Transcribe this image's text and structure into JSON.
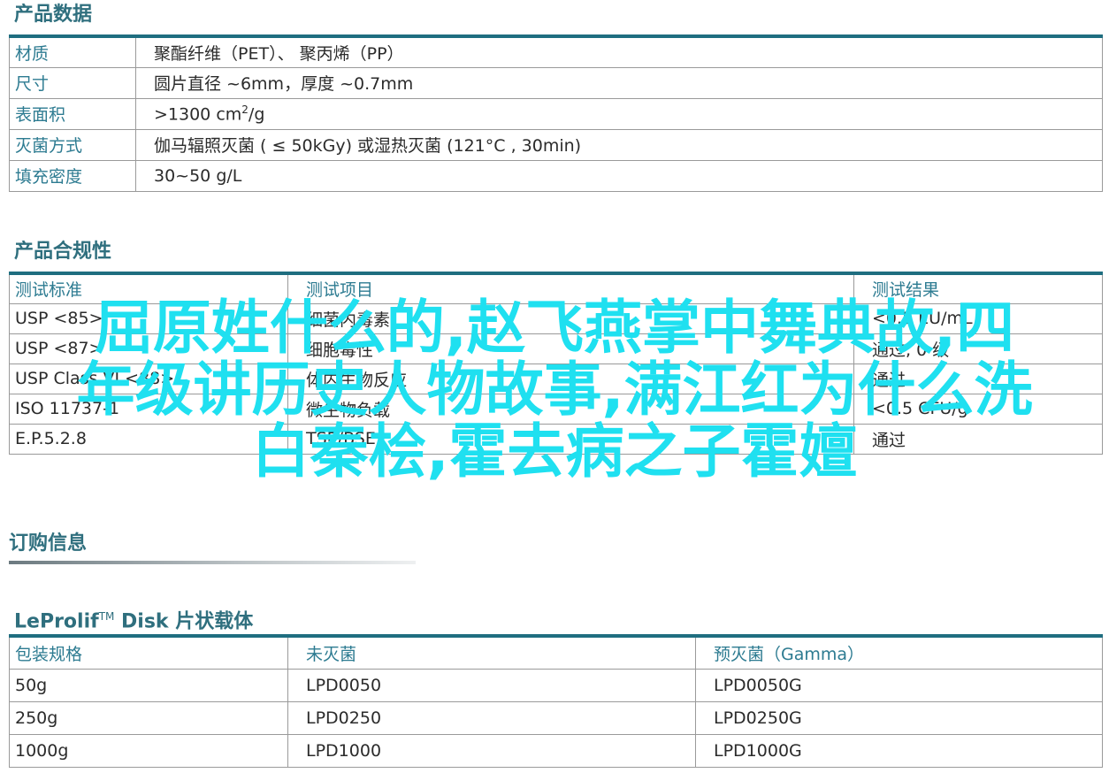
{
  "product_data": {
    "title": "产品数据",
    "rows": [
      {
        "key": "材质",
        "value": "聚酯纤维（PET）、 聚丙烯（PP）"
      },
      {
        "key": "尺寸",
        "value": "圆片直径 ~6mm，厚度 ~0.7mm"
      },
      {
        "key": "表面积",
        "value_prefix": ">1300 cm",
        "value_sup": "2",
        "value_suffix": "/g"
      },
      {
        "key": "灭菌方式",
        "value": "伽马辐照灭菌 ( ≤ 50kGy) 或湿热灭菌 (121°C , 30min)"
      },
      {
        "key": "填充密度",
        "value": "30~50 g/L"
      }
    ]
  },
  "compliance": {
    "title": "产品合规性",
    "headers": [
      "测试标准",
      "测试项目",
      "测试结果"
    ],
    "rows": [
      [
        "USP <85>",
        "细菌内毒素",
        "<0.5 EU/mL"
      ],
      [
        "USP <87>",
        "细胞毒性",
        "通过, 0 级"
      ],
      [
        "USP Class VI <88>",
        "体内生物反应",
        "通过"
      ],
      [
        "ISO 11737-1",
        "微生物负载",
        "<0.5 CFU/g"
      ],
      [
        "E.P.5.2.8",
        "TSE/BSE",
        "通过"
      ]
    ]
  },
  "order": {
    "title": "订购信息"
  },
  "disk": {
    "title_brand": "LeProlif",
    "title_tm": "TM",
    "title_rest": " Disk 片状载体",
    "headers": [
      "包装规格",
      "未灭菌",
      "预灭菌（Gamma）"
    ],
    "rows": [
      [
        "50g",
        "LPD0050",
        "LPD0050G"
      ],
      [
        "250g",
        "LPD0250",
        "LPD0250G"
      ],
      [
        "1000g",
        "LPD1000",
        "LPD1000G"
      ]
    ]
  },
  "overlay": {
    "lines": [
      "屈原姓什么的,赵飞燕掌中舞典故,四",
      "年级讲历史人物故事,满江红为什么洗",
      "白秦桧,霍去病之子霍嬗"
    ]
  }
}
